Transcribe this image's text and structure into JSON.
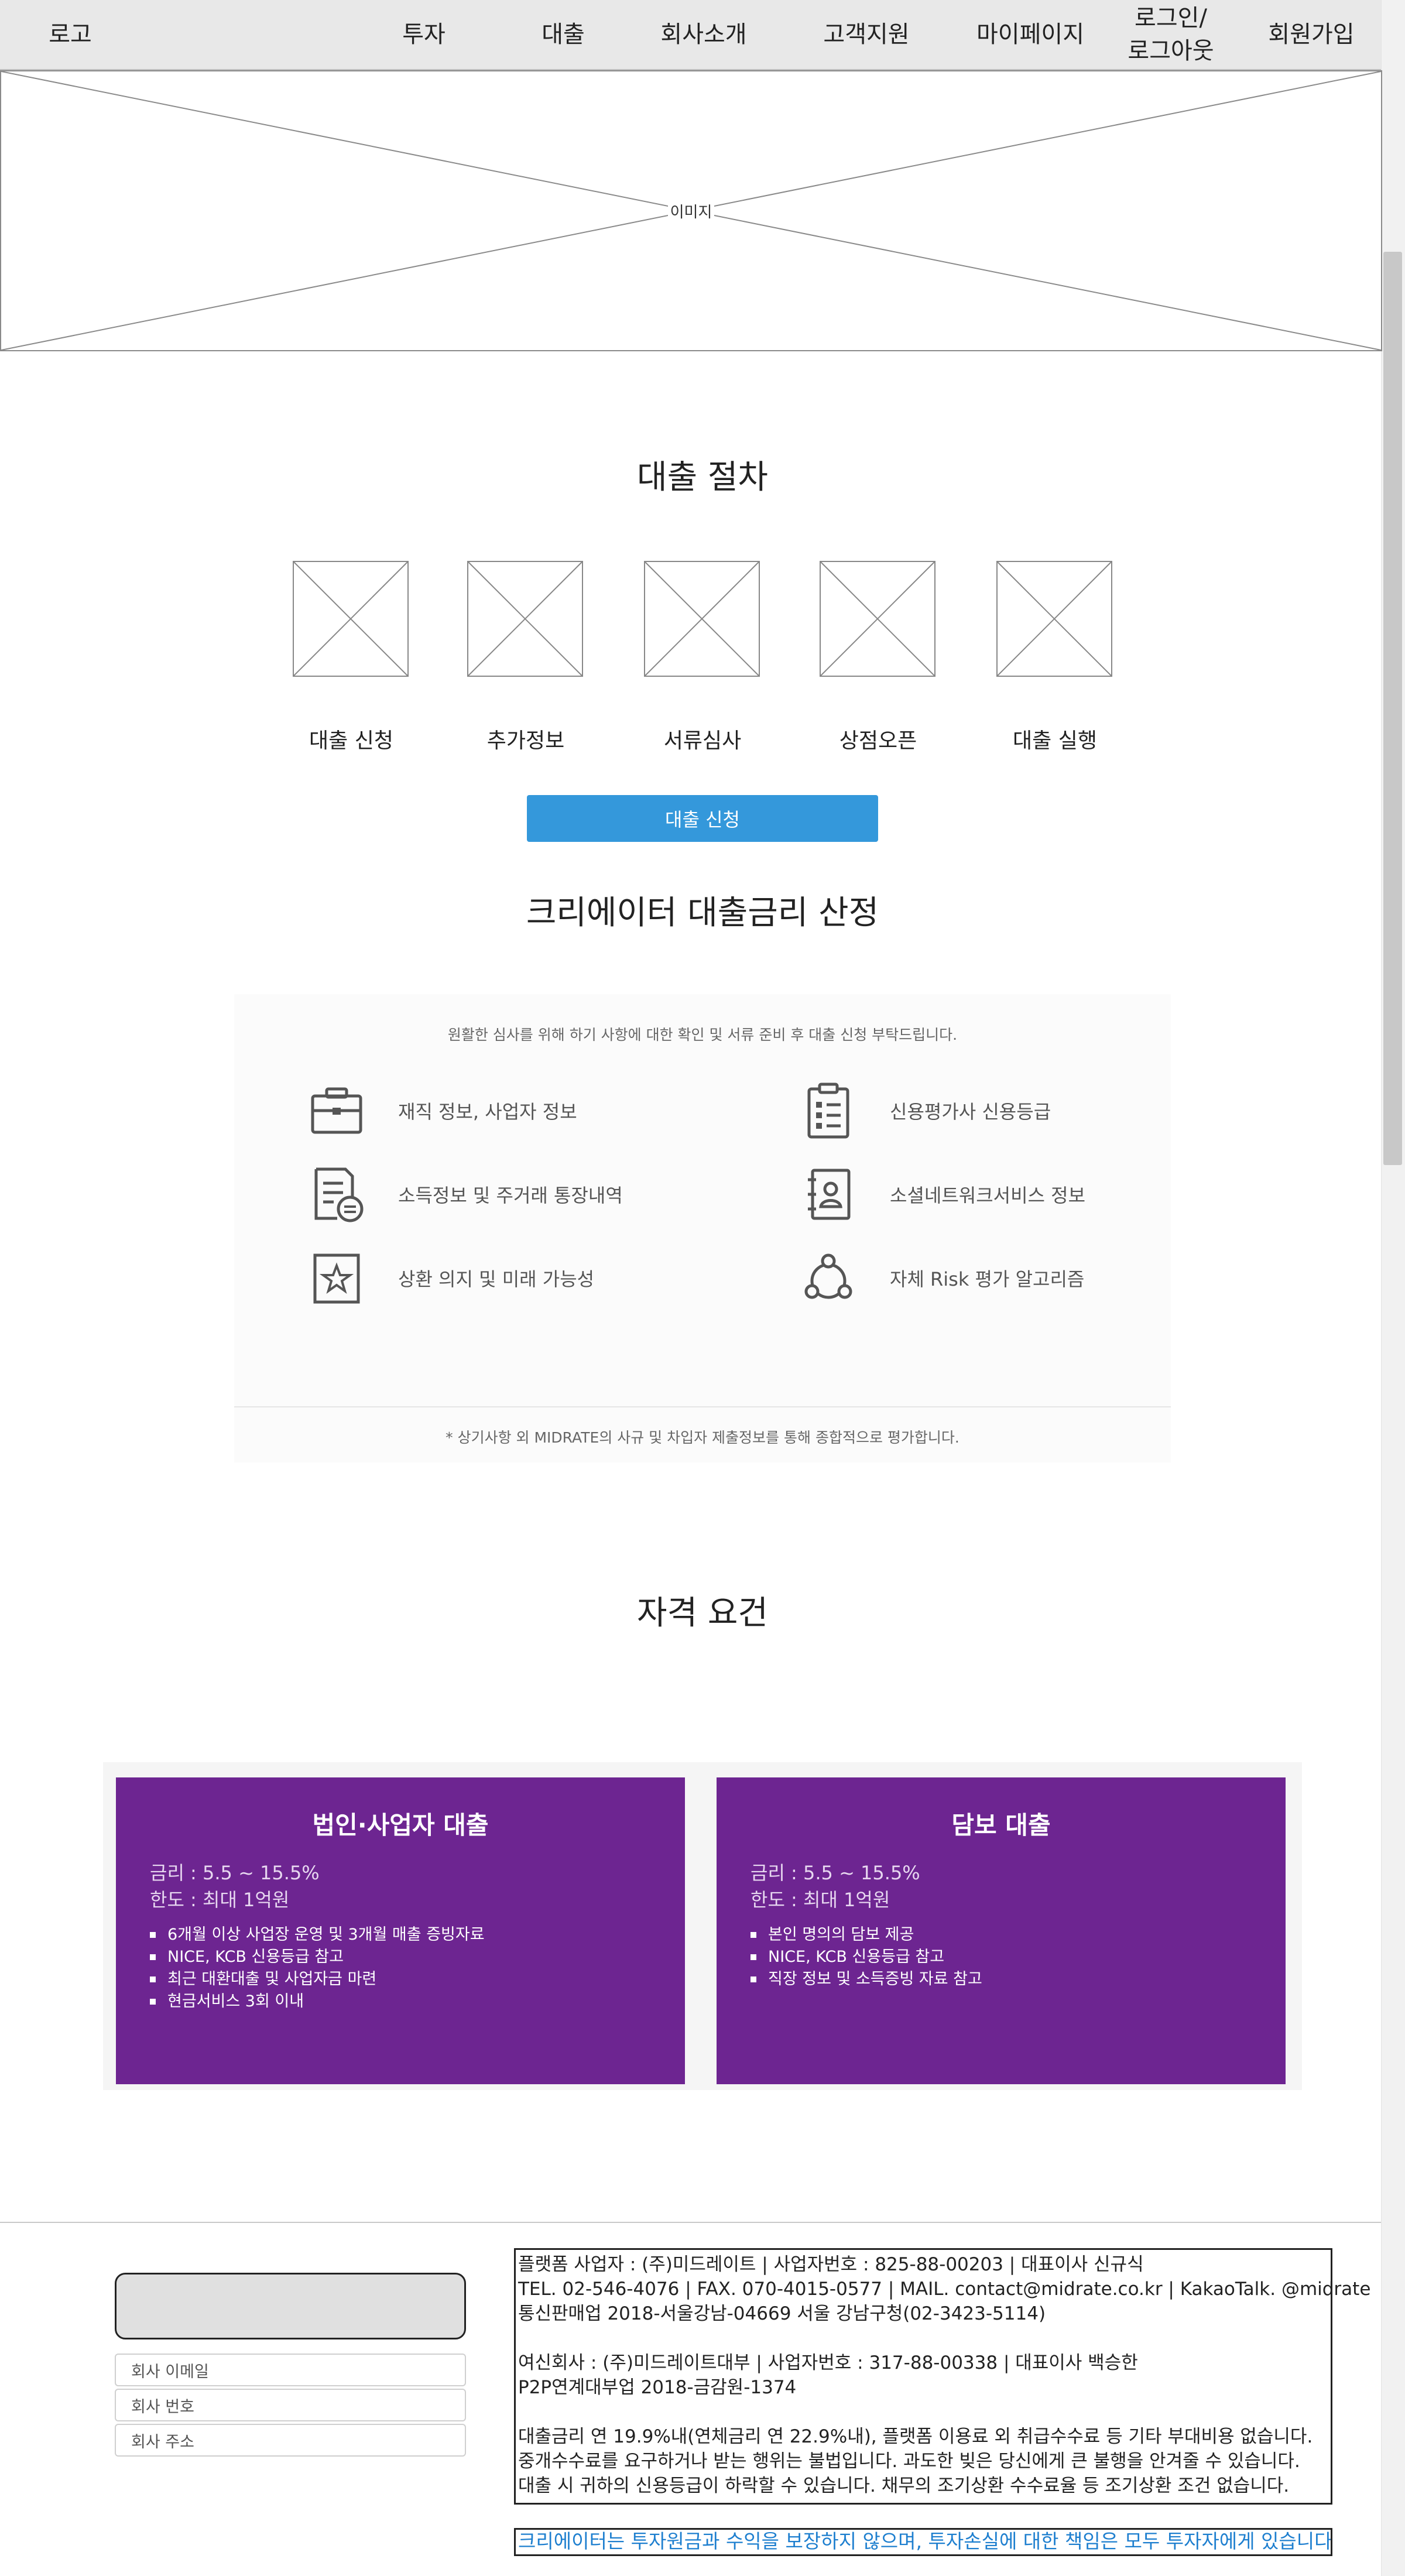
{
  "nav": {
    "logo": "로고",
    "items": [
      {
        "label": "투자"
      },
      {
        "label": "대출"
      },
      {
        "label": "회사소개"
      },
      {
        "label": "고객지원"
      },
      {
        "label": "마이페이지"
      },
      {
        "label": "로그인/\n로그아웃"
      },
      {
        "label": "회원가입"
      }
    ]
  },
  "hero": {
    "placeholder_label": "이미지"
  },
  "process": {
    "title": "대출 절차",
    "steps": [
      {
        "label": "대출 신청"
      },
      {
        "label": "추가정보"
      },
      {
        "label": "서류심사"
      },
      {
        "label": "상점오픈"
      },
      {
        "label": "대출 실행"
      }
    ],
    "apply_button": "대출 신청"
  },
  "rate": {
    "title": "크리에이터 대출금리 산정",
    "intro": "원활한 심사를 위해 하기 사항에 대한 확인 및 서류 준비 후 대출 신청 부탁드립니다.",
    "criteria": [
      {
        "icon": "briefcase-icon",
        "label": "재직 정보, 사업자 정보"
      },
      {
        "icon": "clipboard-icon",
        "label": "신용평가사 신용등급"
      },
      {
        "icon": "document-coin-icon",
        "label": "소득정보 및 주거래 통장내역"
      },
      {
        "icon": "contact-book-icon",
        "label": "소셜네트워크서비스 정보"
      },
      {
        "icon": "star-frame-icon",
        "label": "상환 의지 및 미래 가능성"
      },
      {
        "icon": "network-icon",
        "label": "자체 Risk 평가 알고리즘"
      }
    ],
    "note": "* 상기사항 외 MIDRATE의 사규 및 차입자 제출정보를 통해 종합적으로 평가합니다."
  },
  "eligibility": {
    "title": "자격 요건",
    "cards": [
      {
        "title": "법인·사업자 대출",
        "rate": "금리 : 5.5 ~ 15.5%",
        "limit": "한도 : 최대 1억원",
        "items": [
          "6개월 이상 사업장 운영 및 3개월 매출 증빙자료",
          "NICE, KCB 신용등급 참고",
          "최근 대환대출 및 사업자금 마련",
          "현금서비스 3회 이내"
        ]
      },
      {
        "title": "담보 대출",
        "rate": "금리 : 5.5 ~ 15.5%",
        "limit": "한도 : 최대 1억원",
        "items": [
          "본인 명의의 담보 제공",
          "NICE, KCB 신용등급 참고",
          "직장 정보 및 소득증빙 자료 참고"
        ]
      }
    ]
  },
  "footer": {
    "fields": {
      "email": "회사 이메일",
      "phone": "회사 번호",
      "address": "회사 주소"
    },
    "info_lines": [
      "플랫폼 사업자 : (주)미드레이트 | 사업자번호 : 825-88-00203 | 대표이사 신규식",
      "TEL. 02-546-4076 | FAX. 070-4015-0577 | MAIL. contact@midrate.co.kr | KakaoTalk. @midrate",
      "통신판매업 2018-서울강남-04669 서울 강남구청(02-3423-5114)",
      "",
      "여신회사 : (주)미드레이트대부 | 사업자번호 : 317-88-00338 | 대표이사 백승한",
      "P2P연계대부업 2018-금감원-1374",
      "",
      "대출금리 연 19.9%내(연체금리 연 22.9%내), 플랫폼 이용료 외 취급수수료 등 기타 부대비용 없습니다.",
      "중개수수료를 요구하거나 받는 행위는 불법입니다. 과도한 빚은 당신에게 큰 불행을 안겨줄 수 있습니다.",
      "대출 시 귀하의 신용등급이 하락할 수 있습니다. 채무의 조기상환 수수료율 등 조기상환 조건 없습니다."
    ],
    "warning": "크리에이터는 투자원금과 수익을 보장하지 않으며, 투자손실에 대한 책임은 모두 투자자에게 있습니다."
  },
  "colors": {
    "accent_button": "#3498db",
    "card_purple": "#6d2591",
    "warning_text": "#1e7fcf"
  }
}
